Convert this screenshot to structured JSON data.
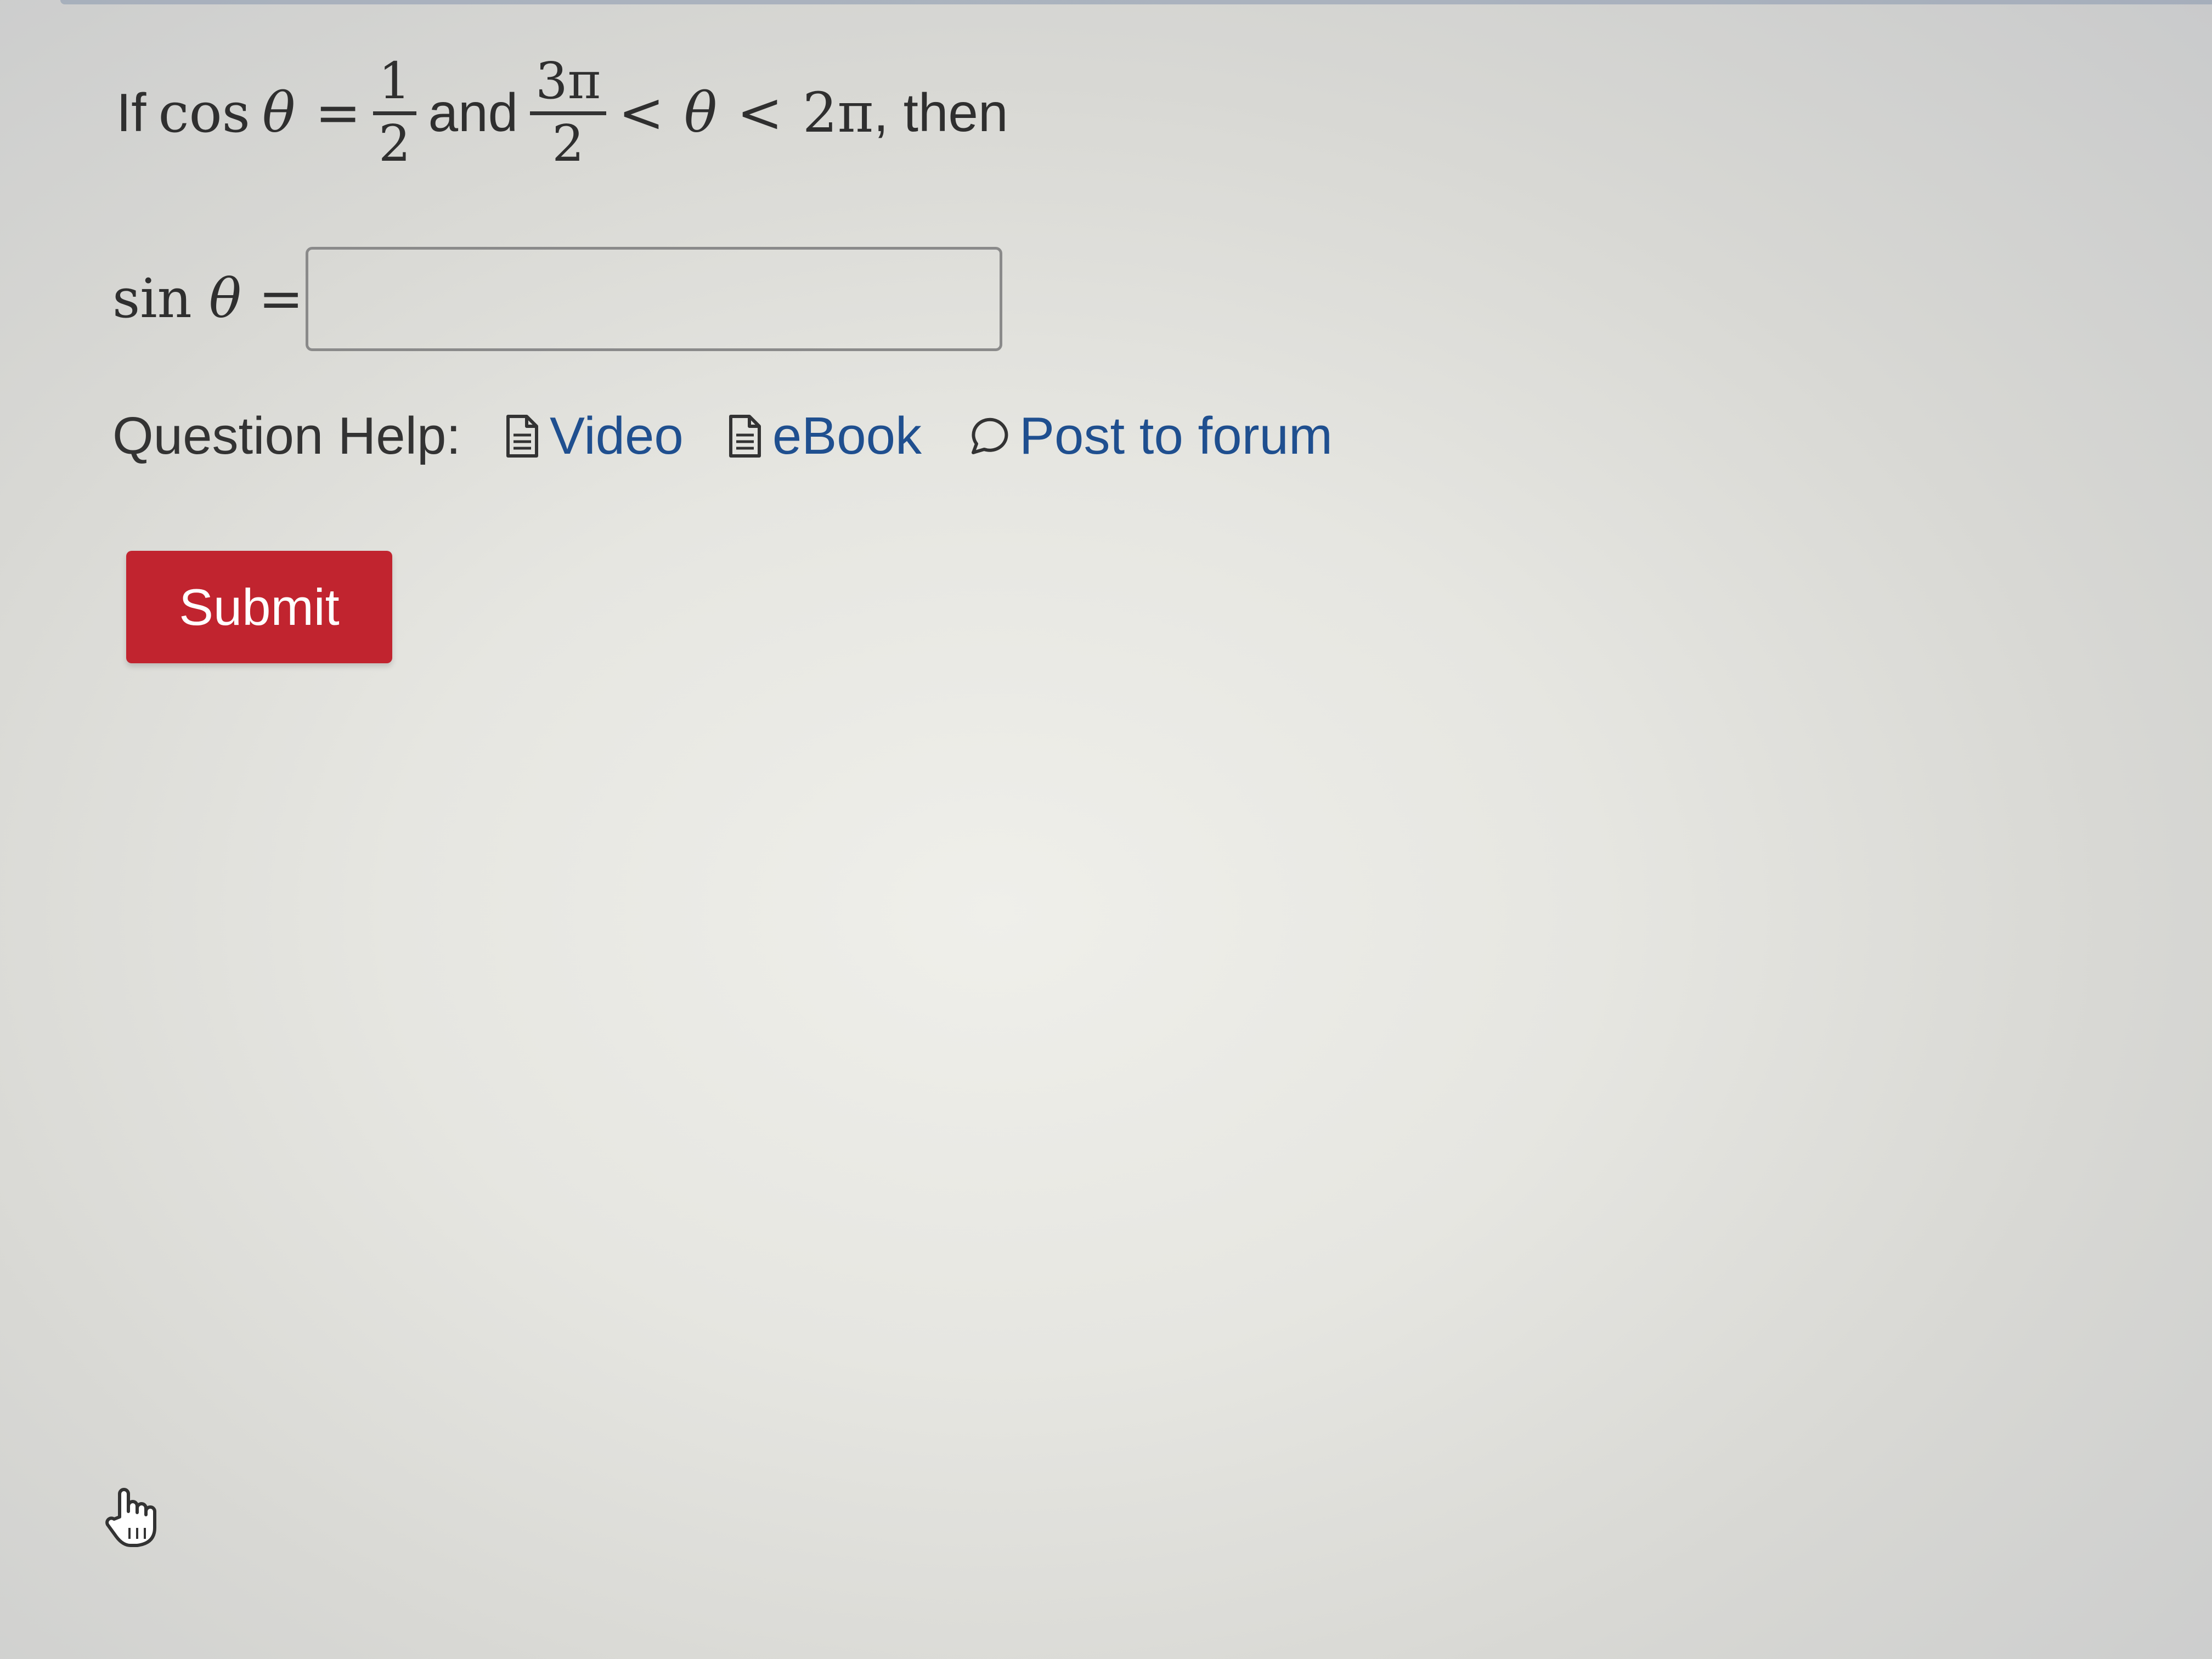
{
  "question": {
    "prefix": "If",
    "cos_func": "cos",
    "theta": "θ",
    "equals": "=",
    "frac1_num": "1",
    "frac1_den": "2",
    "and": "and",
    "frac2_num": "3π",
    "frac2_den": "2",
    "less_than": "<",
    "upper": "2π",
    "suffix": ", then"
  },
  "answer": {
    "sin_func": "sin",
    "theta": "θ",
    "equals": "=",
    "value": "",
    "placeholder": ""
  },
  "help": {
    "label": "Question Help:",
    "video": "Video",
    "ebook": "eBook",
    "forum": "Post to forum"
  },
  "submit": {
    "label": "Submit"
  },
  "colors": {
    "submit_bg": "#c1242f",
    "link": "#1f4f8f"
  },
  "icons": {
    "video": "document-icon",
    "ebook": "document-icon",
    "forum": "speech-bubble-icon",
    "cursor": "hand-pointer-icon"
  }
}
